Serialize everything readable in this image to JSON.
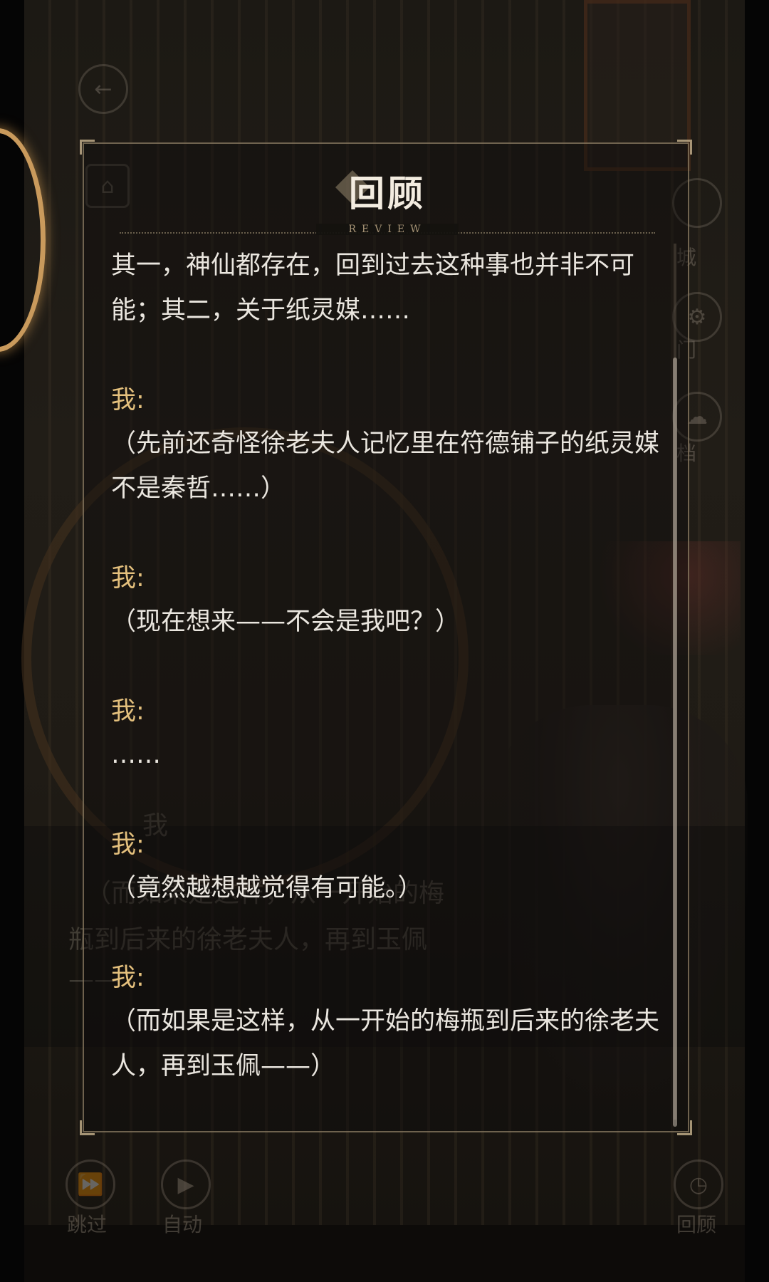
{
  "review": {
    "title": "回顾",
    "subtitle": "REVIEW",
    "entries": [
      {
        "speaker": "",
        "text": "其一，神仙都存在，回到过去这种事也并非不可能；其二，关于纸灵媒……"
      },
      {
        "speaker": "我:",
        "text": "（先前还奇怪徐老夫人记忆里在符德铺子的纸灵媒不是秦哲……）"
      },
      {
        "speaker": "我:",
        "text": "（现在想来——不会是我吧？）"
      },
      {
        "speaker": "我:",
        "text": "……"
      },
      {
        "speaker": "我:",
        "text": "（竟然越想越觉得有可能。）"
      },
      {
        "speaker": "我:",
        "text": "（而如果是这样，从一开始的梅瓶到后来的徐老夫人，再到玉佩——）"
      }
    ]
  },
  "background": {
    "dialog_speaker": "我",
    "dialog_text_1": "（而如果是这样，从一开始的梅",
    "dialog_text_2": "瓶到后来的徐老夫人，再到玉佩",
    "dialog_text_3": "——"
  },
  "hud": {
    "skip_label": "跳过",
    "auto_label": "自动",
    "review_label": "回顾",
    "side_1": "城",
    "side_2": "门",
    "side_3": "档"
  },
  "colors": {
    "speaker": "#e4c07d",
    "text": "#eae6df",
    "panel_border": "#96846a"
  }
}
